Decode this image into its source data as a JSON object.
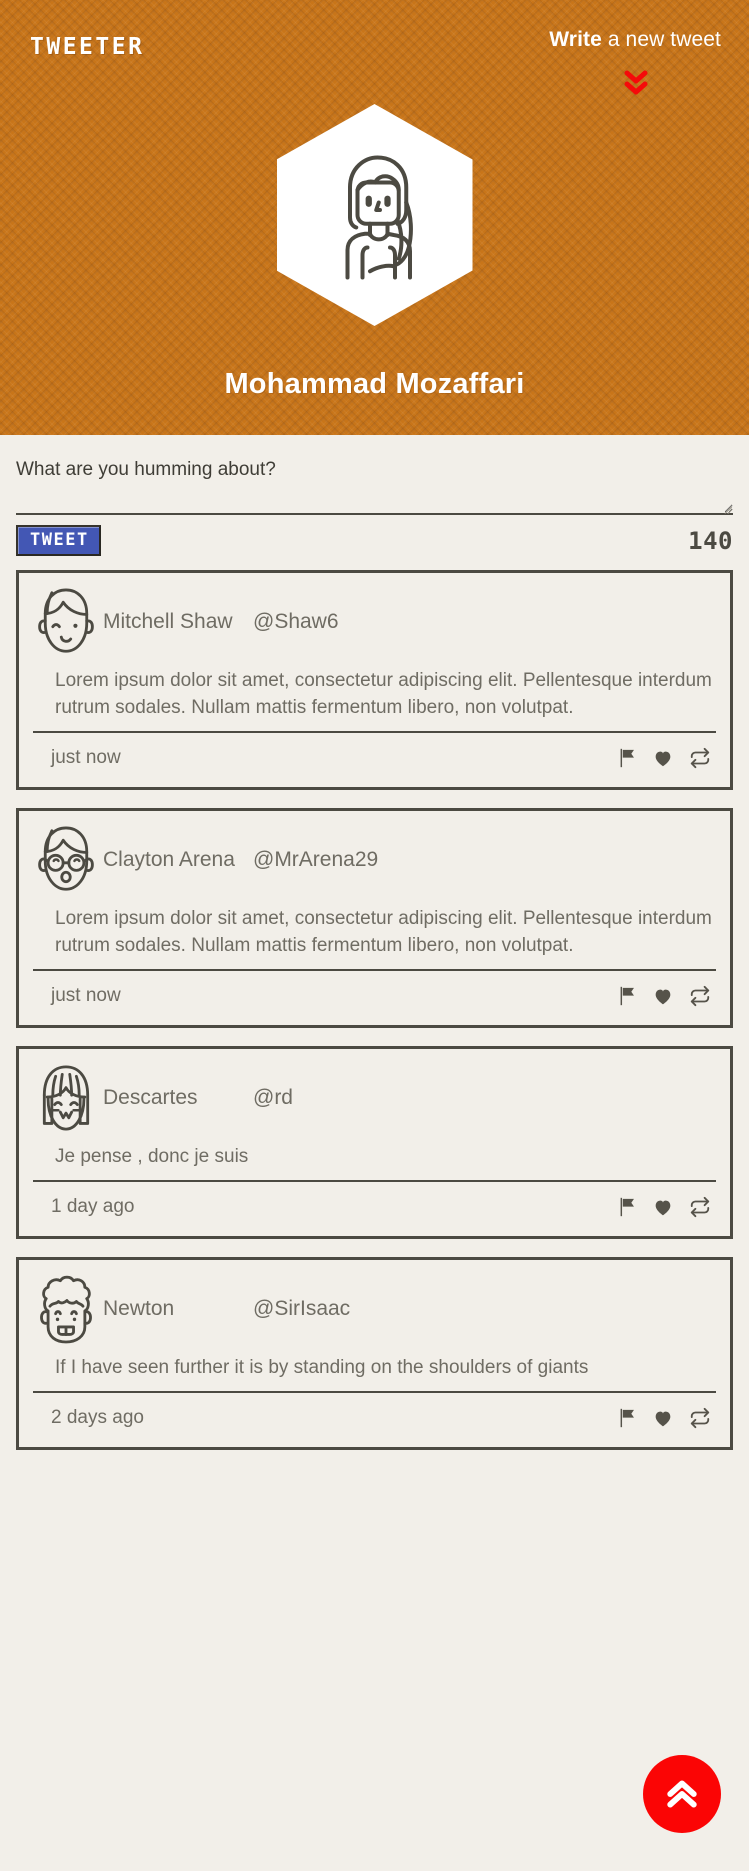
{
  "header": {
    "logo": "TWEETER",
    "write_link_strong": "Write",
    "write_link_rest": " a new tweet",
    "chevron_down_icon": "chevron-double-down-icon",
    "avatar_icon": "woman-long-hair-avatar-icon",
    "profile_name": "Mohammad Mozaffari",
    "background_color": "#c87519"
  },
  "compose": {
    "placeholder": "What are you humming about?",
    "value": "",
    "tweet_button_label": "TWEET",
    "tweet_button_color": "#4357b4",
    "char_count": "140"
  },
  "feed": {
    "tweets": [
      {
        "avatar_icon": "man-short-hair-avatar-icon",
        "author": "Mitchell Shaw",
        "handle": "@Shaw6",
        "text": "Lorem ipsum dolor sit amet, consectetur adipiscing elit. Pellentesque interdum rutrum sodales. Nullam mattis fermentum libero, non volutpat.",
        "time": "just now",
        "actions": [
          "flag-icon",
          "heart-icon",
          "retweet-icon"
        ]
      },
      {
        "avatar_icon": "man-glasses-avatar-icon",
        "author": "Clayton Arena",
        "handle": "@MrArena29",
        "text": "Lorem ipsum dolor sit amet, consectetur adipiscing elit. Pellentesque interdum rutrum sodales. Nullam mattis fermentum libero, non volutpat.",
        "time": "just now",
        "actions": [
          "flag-icon",
          "heart-icon",
          "retweet-icon"
        ]
      },
      {
        "avatar_icon": "woman-bangs-avatar-icon",
        "author": "Descartes",
        "handle": "@rd",
        "text": "Je pense , donc je suis",
        "time": "1 day ago",
        "actions": [
          "flag-icon",
          "heart-icon",
          "retweet-icon"
        ]
      },
      {
        "avatar_icon": "man-curly-wig-avatar-icon",
        "author": "Newton",
        "handle": "@SirIsaac",
        "text": "If I have seen further it is by standing on the shoulders of giants",
        "time": "2 days ago",
        "actions": [
          "flag-icon",
          "heart-icon",
          "retweet-icon"
        ]
      }
    ]
  },
  "fab": {
    "icon": "chevron-double-up-icon",
    "color": "#fb0505"
  }
}
